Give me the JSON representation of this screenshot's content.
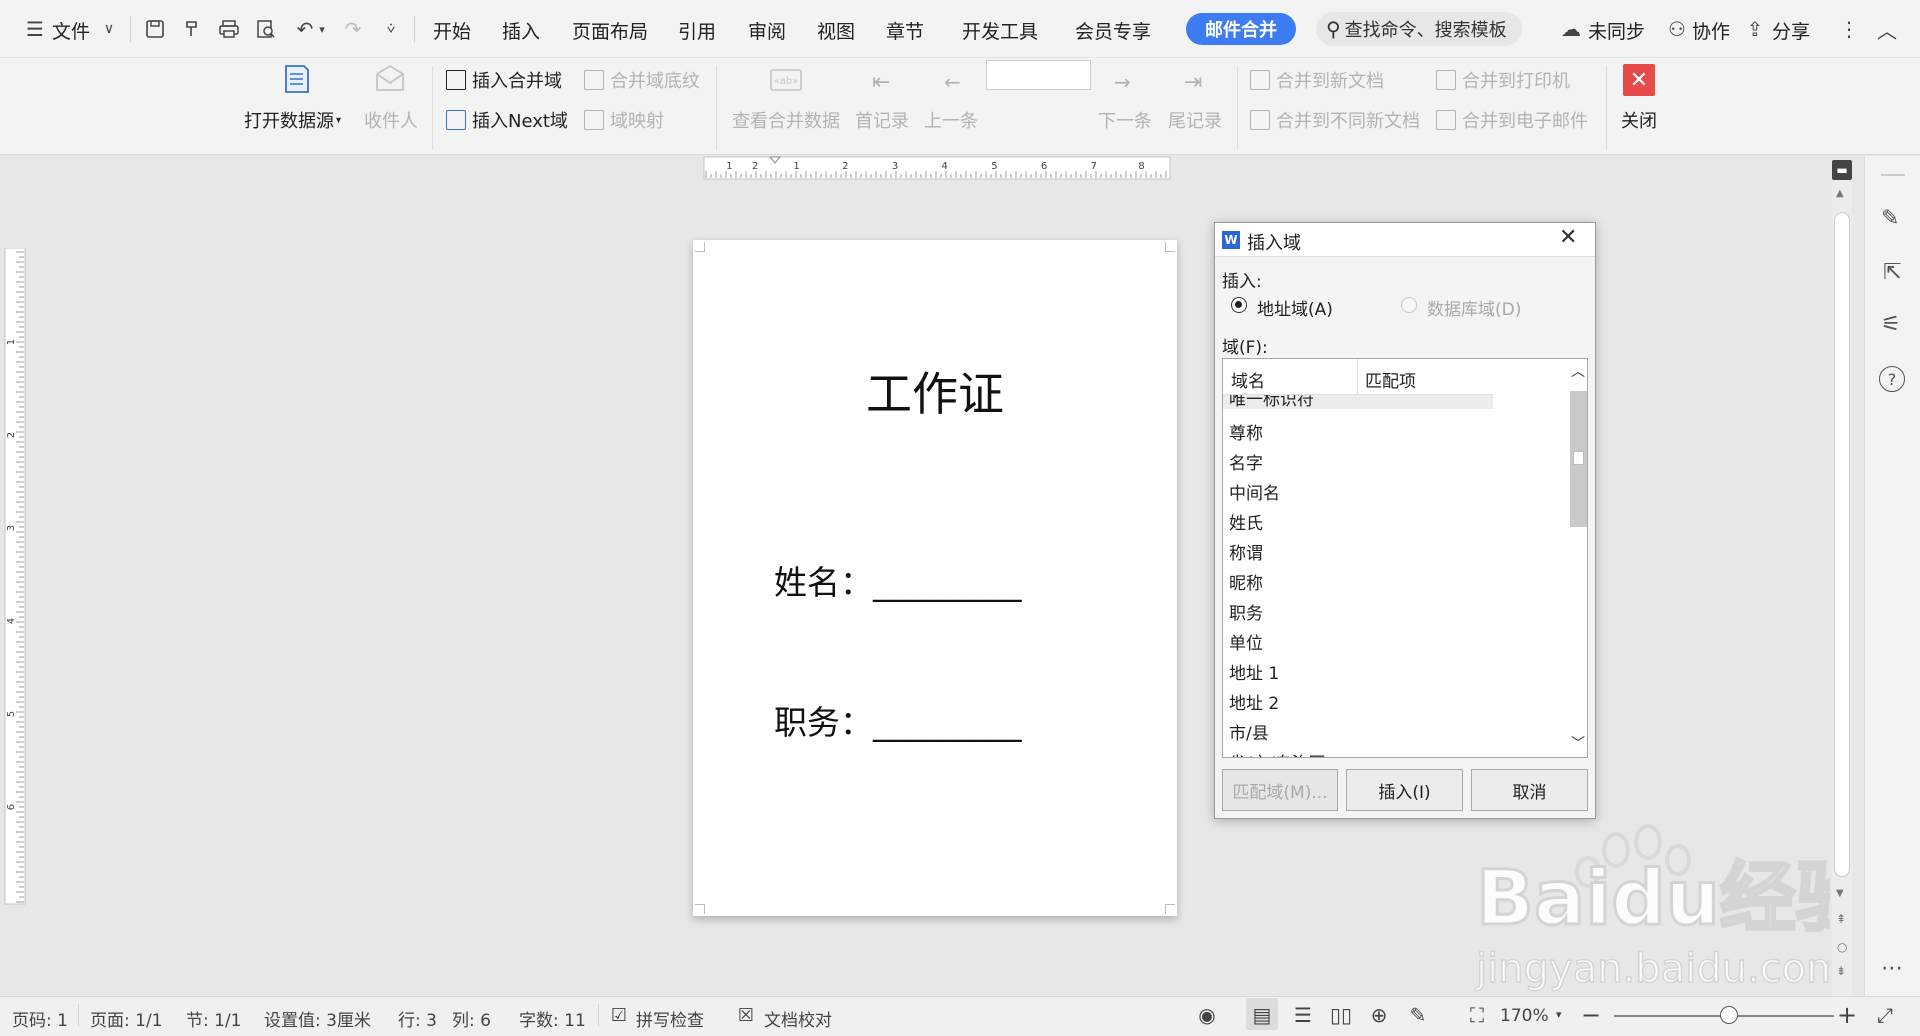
{
  "menubar": {
    "file_label": "文件",
    "tabs": [
      "开始",
      "插入",
      "页面布局",
      "引用",
      "审阅",
      "视图",
      "章节",
      "开发工具",
      "会员专享"
    ],
    "active_tab": "邮件合并",
    "search_placeholder": "查找命令、搜索模板",
    "sync_label": "未同步",
    "collab_label": "协作",
    "share_label": "分享"
  },
  "ribbon": {
    "open_datasource": "打开数据源",
    "recipients": "收件人",
    "insert_merge_field": "插入合并域",
    "insert_next_field": "插入Next域",
    "merge_field_shading": "合并域底纹",
    "field_mapping": "域映射",
    "view_merged_data": "查看合并数据",
    "first_record": "首记录",
    "prev_record": "上一条",
    "next_record": "下一条",
    "last_record": "尾记录",
    "merge_to_new_doc": "合并到新文档",
    "merge_to_diff_docs": "合并到不同新文档",
    "merge_to_printer": "合并到打印机",
    "merge_to_email": "合并到电子邮件",
    "close": "关闭"
  },
  "document": {
    "title": "工作证",
    "line1": "姓名：_________",
    "line2": "职务：_________"
  },
  "ruler": {
    "h_ticks": [
      "1",
      "2",
      "1",
      "2",
      "3",
      "4",
      "5",
      "6",
      "7",
      "8"
    ],
    "v_ticks": [
      "1",
      "2",
      "3",
      "4",
      "5",
      "6"
    ]
  },
  "dialog": {
    "title": "插入域",
    "insert_label": "插入:",
    "radio_address": "地址域(A)",
    "radio_database": "数据库域(D)",
    "fields_label": "域(F):",
    "col_name": "域名",
    "col_match": "匹配项",
    "items": [
      "唯一标识符",
      "尊称",
      "名字",
      "中间名",
      "姓氏",
      "称谓",
      "昵称",
      "职务",
      "单位",
      "地址 1",
      "地址 2",
      "市/县",
      "省/市/自治区"
    ],
    "btn_match": "匹配域(M)...",
    "btn_insert": "插入(I)",
    "btn_cancel": "取消"
  },
  "statusbar": {
    "page_num": "页码: 1",
    "pages": "页面: 1/1",
    "section": "节: 1/1",
    "setting": "设置值: 3厘米",
    "row": "行: 3",
    "col": "列: 6",
    "words": "字数: 11",
    "spell": "拼写检查",
    "proof": "文档校对",
    "zoom": "170%"
  },
  "watermark": {
    "brand": "Baidu经验",
    "url": "jingyan.baidu.com"
  },
  "colors": {
    "accent": "#3e7cf4",
    "close_red": "#e84a4a"
  }
}
